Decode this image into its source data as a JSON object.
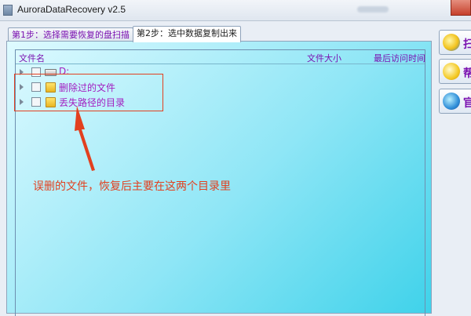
{
  "window": {
    "title": "AuroraDataRecovery v2.5"
  },
  "tabs": [
    {
      "label": "第1步：选择需要恢复的盘扫描"
    },
    {
      "label": "第2步：选中数据复制出来"
    }
  ],
  "list": {
    "columns": {
      "name": "文件名",
      "size": "文件大小",
      "last_access": "最后访问时间"
    },
    "rows": [
      {
        "label": "D:",
        "icon": "drive-icon"
      },
      {
        "label": "删除过的文件",
        "icon": "folder-icon"
      },
      {
        "label": "丢失路径的目录",
        "icon": "folder-icon"
      }
    ]
  },
  "annotation": {
    "text": "误删的文件，恢复后主要在这两个目录里",
    "color": "#e2401f"
  },
  "side_buttons": [
    {
      "icon": "magnifier-icon",
      "partial_label": "扫"
    },
    {
      "icon": "chat-icon",
      "partial_label": "帮"
    },
    {
      "icon": "globe-icon",
      "partial_label": "官"
    }
  ],
  "colors": {
    "accent_text": "#7a10b0",
    "panel_gradient": [
      "#dffaff",
      "#3fd2ea"
    ]
  }
}
